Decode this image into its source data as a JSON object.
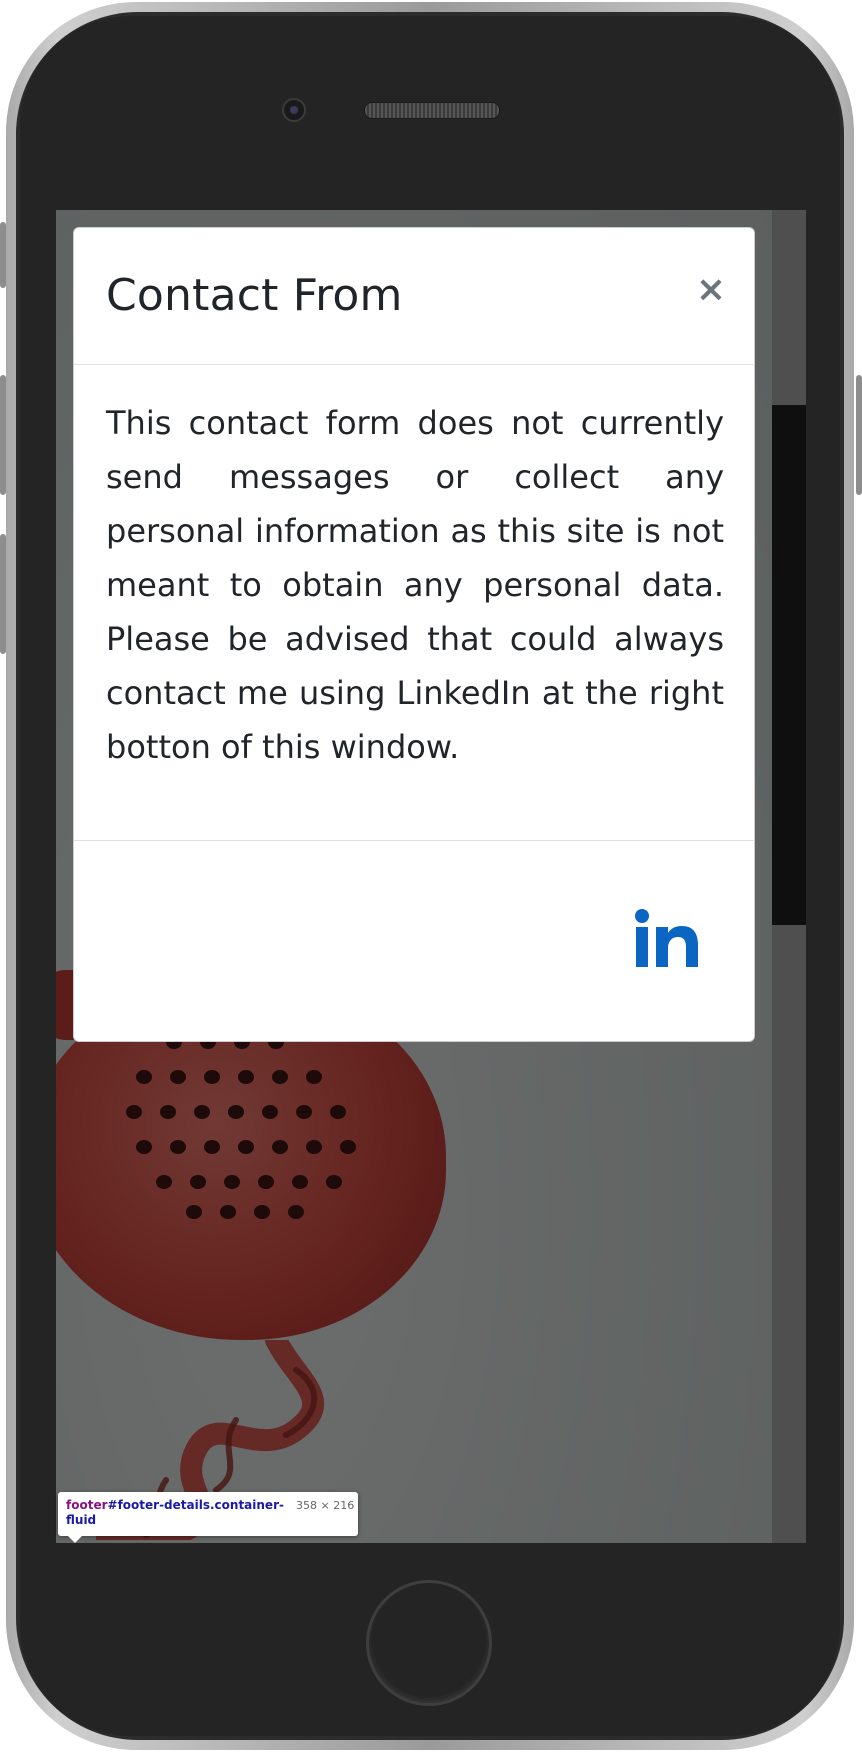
{
  "modal": {
    "title": "Contact From",
    "close_label": "×",
    "body": "This contact form does not currently send messages or collect any personal information as this site is not meant to obtain any personal data. Please be advised that could always contact me using LinkedIn at the right botton of this window.",
    "linkedin_icon": "linkedin-icon",
    "linkedin_color": "#0a66c2"
  },
  "devtools_tooltip": {
    "tag": "footer",
    "id_class": "#footer-details.container-fluid",
    "size": "358 × 216"
  },
  "colors": {
    "overlay": "rgba(0,0,0,0.5)",
    "title_text": "#212529",
    "close_icon": "#6c757d",
    "receiver_red": "#c9463e"
  }
}
